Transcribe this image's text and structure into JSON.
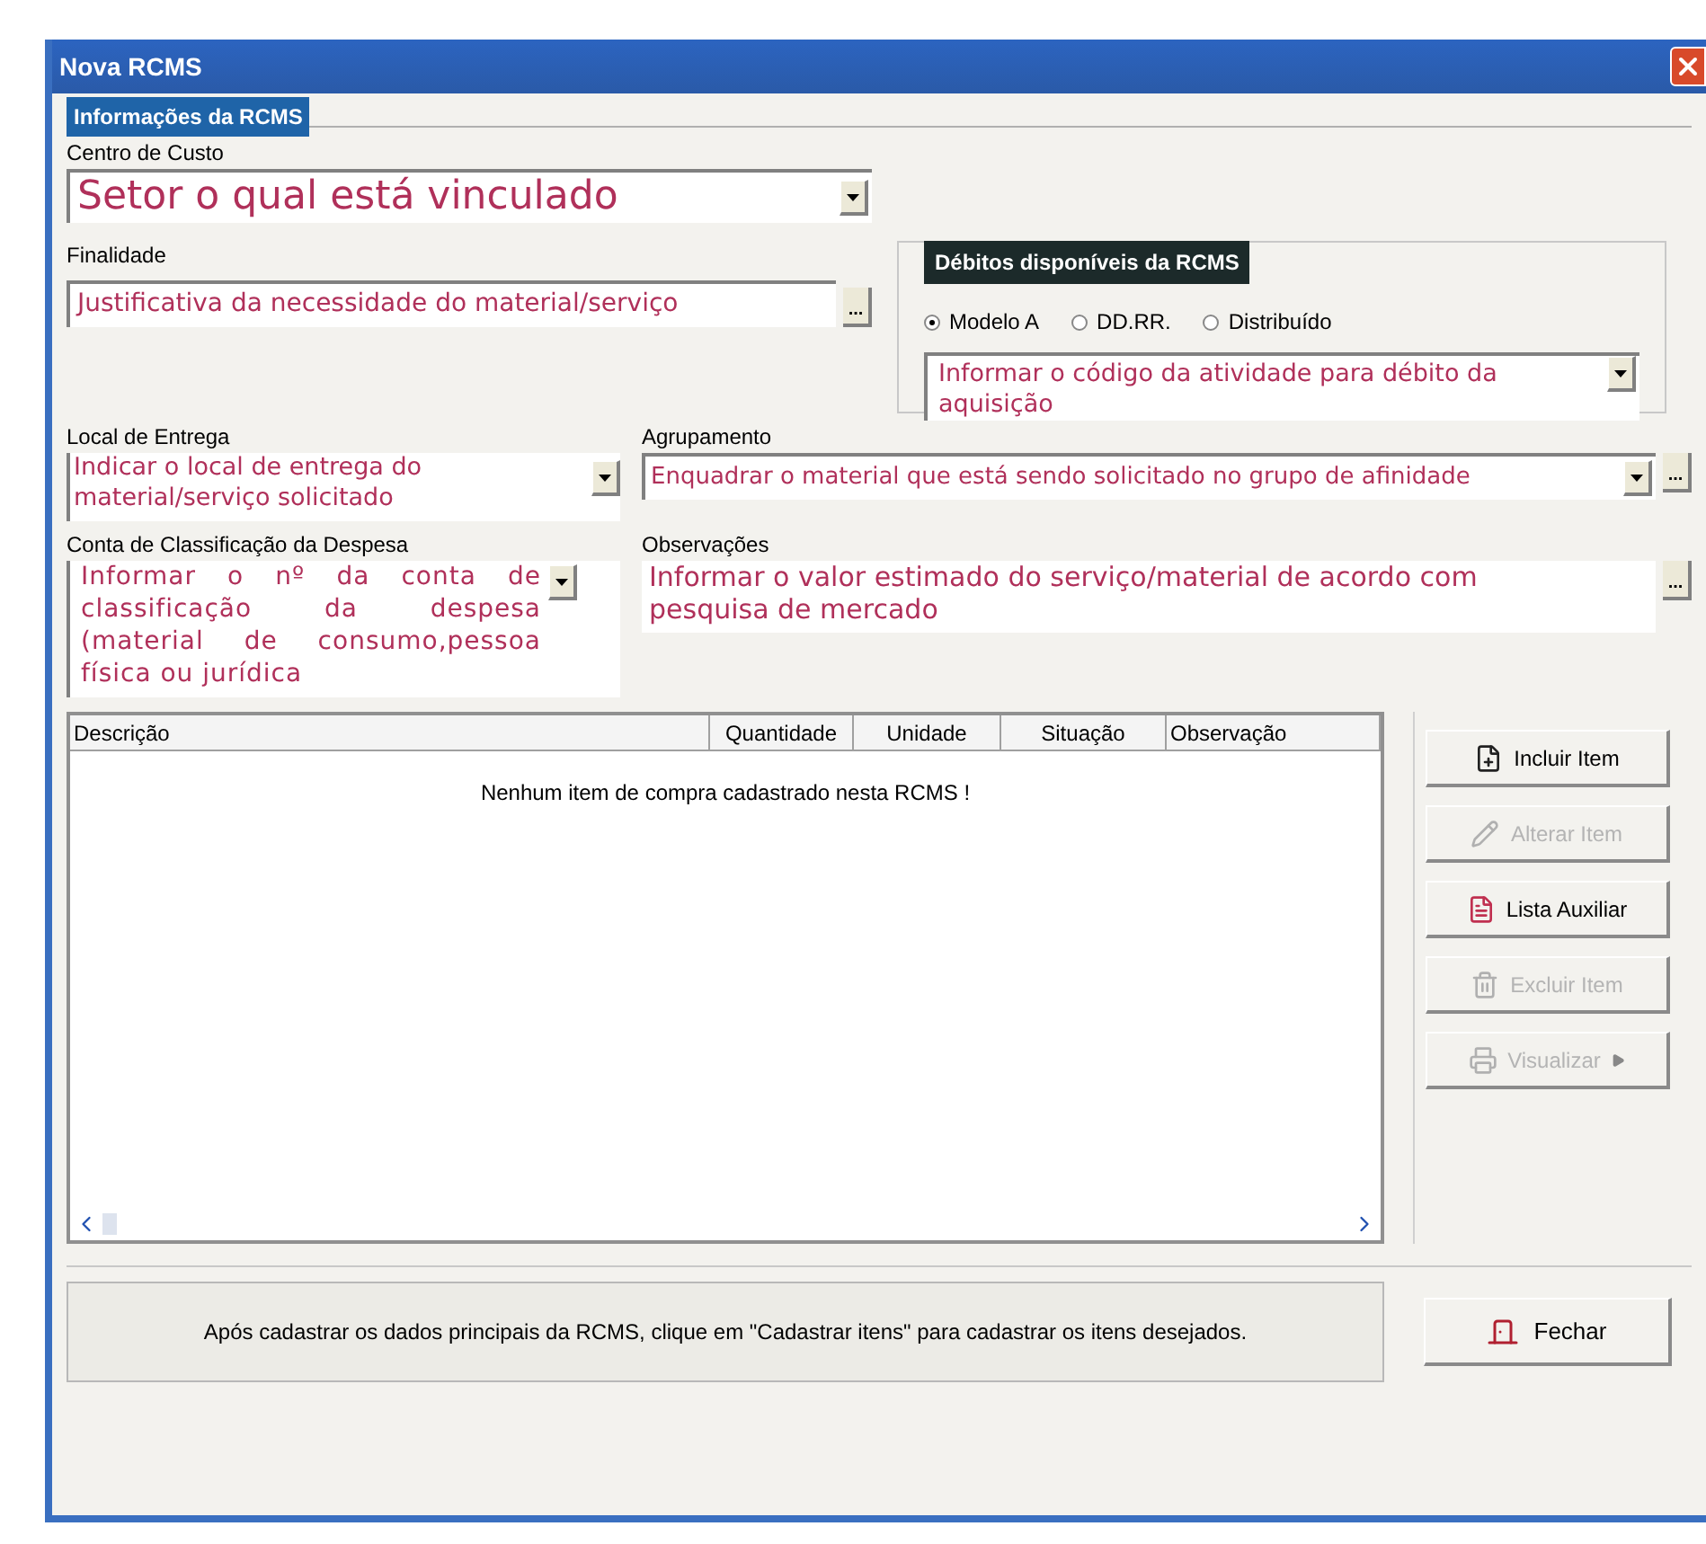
{
  "window": {
    "title": "Nova RCMS"
  },
  "section": {
    "title": "Informações da RCMS"
  },
  "cost_center": {
    "label": "Centro de Custo",
    "value": "Setor o qual está vinculado"
  },
  "purpose": {
    "label": "Finalidade",
    "value": "Justificativa da necessidade do material/serviço",
    "ellipsis": "..."
  },
  "debits": {
    "title": "Débitos disponíveis da RCMS",
    "options": [
      {
        "label": "Modelo A",
        "selected": true
      },
      {
        "label": "DD.RR.",
        "selected": false
      },
      {
        "label": "Distribuído",
        "selected": false
      }
    ],
    "activity": "Informar o código da atividade para débito da aquisição"
  },
  "delivery": {
    "label": "Local de Entrega",
    "value": "Indicar o local de entrega do material/serviço solicitado"
  },
  "grouping": {
    "label": "Agrupamento",
    "value": "Enquadrar o material que está sendo solicitado no grupo de afinidade",
    "ellipsis": "..."
  },
  "expense_account": {
    "label": "Conta de Classificação da Despesa",
    "value": "Informar o nº da conta de classificação da despesa (material de consumo,pessoa física ou jurídica"
  },
  "notes": {
    "label": "Observações",
    "value": "Informar o valor estimado do serviço/material de acordo com pesquisa de mercado",
    "ellipsis": "..."
  },
  "table": {
    "columns": [
      "Descrição",
      "Quantidade",
      "Unidade",
      "Situação",
      "Observação"
    ],
    "empty_message": "Nenhum item de compra cadastrado nesta RCMS !"
  },
  "actions": [
    {
      "label": "Incluir Item",
      "kind": "add",
      "disabled": false
    },
    {
      "label": "Alterar Item",
      "kind": "edit",
      "disabled": true
    },
    {
      "label": "Lista Auxiliar",
      "kind": "list",
      "disabled": false
    },
    {
      "label": "Excluir Item",
      "kind": "delete",
      "disabled": true
    },
    {
      "label": "Visualizar",
      "kind": "preview",
      "disabled": true
    }
  ],
  "hint": "Após cadastrar os dados principais da RCMS, clique em \"Cadastrar itens\" para cadastrar os itens desejados.",
  "close_button": {
    "label": "Fechar"
  }
}
